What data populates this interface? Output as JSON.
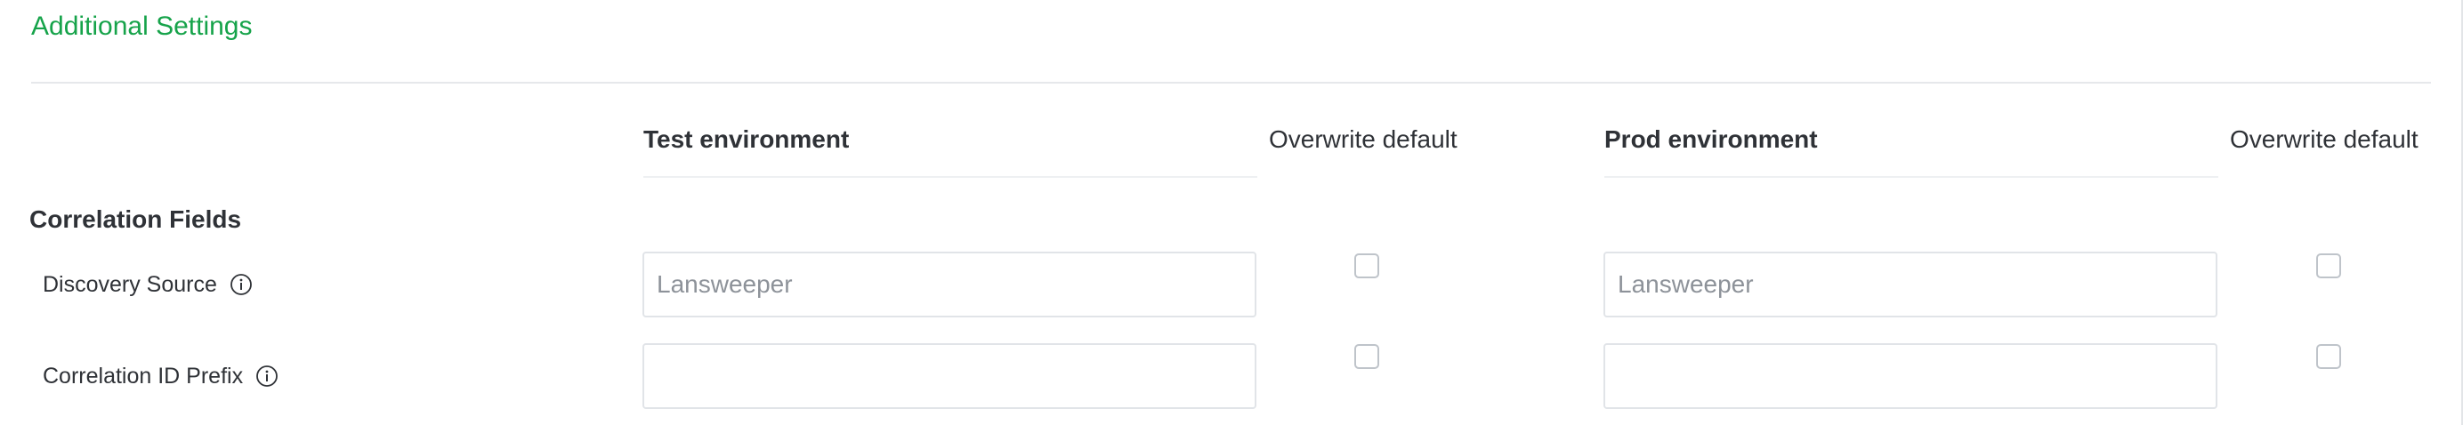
{
  "section": {
    "title": "Additional Settings"
  },
  "columns": {
    "test_env": "Test environment",
    "test_overwrite": "Overwrite default",
    "prod_env": "Prod environment",
    "prod_overwrite": "Overwrite default"
  },
  "group": {
    "title": "Correlation Fields"
  },
  "rows": [
    {
      "label": "Discovery Source",
      "icon": "info-icon",
      "test_value": "",
      "test_placeholder": "Lansweeper",
      "test_overwrite_checked": false,
      "prod_value": "",
      "prod_placeholder": "Lansweeper",
      "prod_overwrite_checked": false
    },
    {
      "label": "Correlation ID Prefix",
      "icon": "info-icon",
      "test_value": "",
      "test_placeholder": "",
      "test_overwrite_checked": false,
      "prod_value": "",
      "prod_placeholder": "",
      "prod_overwrite_checked": false
    }
  ],
  "colors": {
    "accent": "#16a34a",
    "text": "#2f3237",
    "border": "#e1e4e8",
    "placeholder": "#8d9299"
  }
}
